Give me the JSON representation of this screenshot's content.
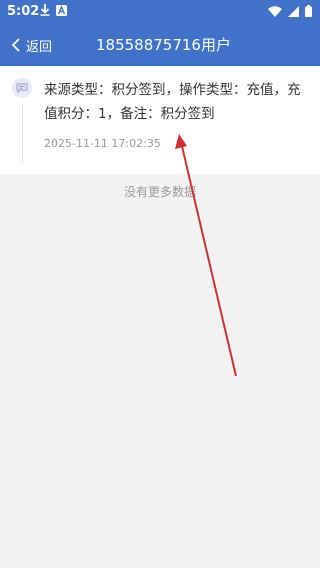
{
  "status_bar": {
    "time": "5:02",
    "left_icons": [
      "download-icon",
      "font-icon"
    ],
    "right_icons": [
      "wifi-icon",
      "signal-icon",
      "battery-icon"
    ]
  },
  "header": {
    "back_label": "返回",
    "title": "18558875716用户"
  },
  "records": [
    {
      "text": "来源类型：积分签到，操作类型：充值，充值积分：1，备注：积分签到",
      "time": "2025-11-11 17:02:35"
    }
  ],
  "footer": {
    "no_more": "没有更多数据"
  },
  "colors": {
    "primary": "#3f72c8",
    "annotation_arrow": "#d32f2f"
  }
}
